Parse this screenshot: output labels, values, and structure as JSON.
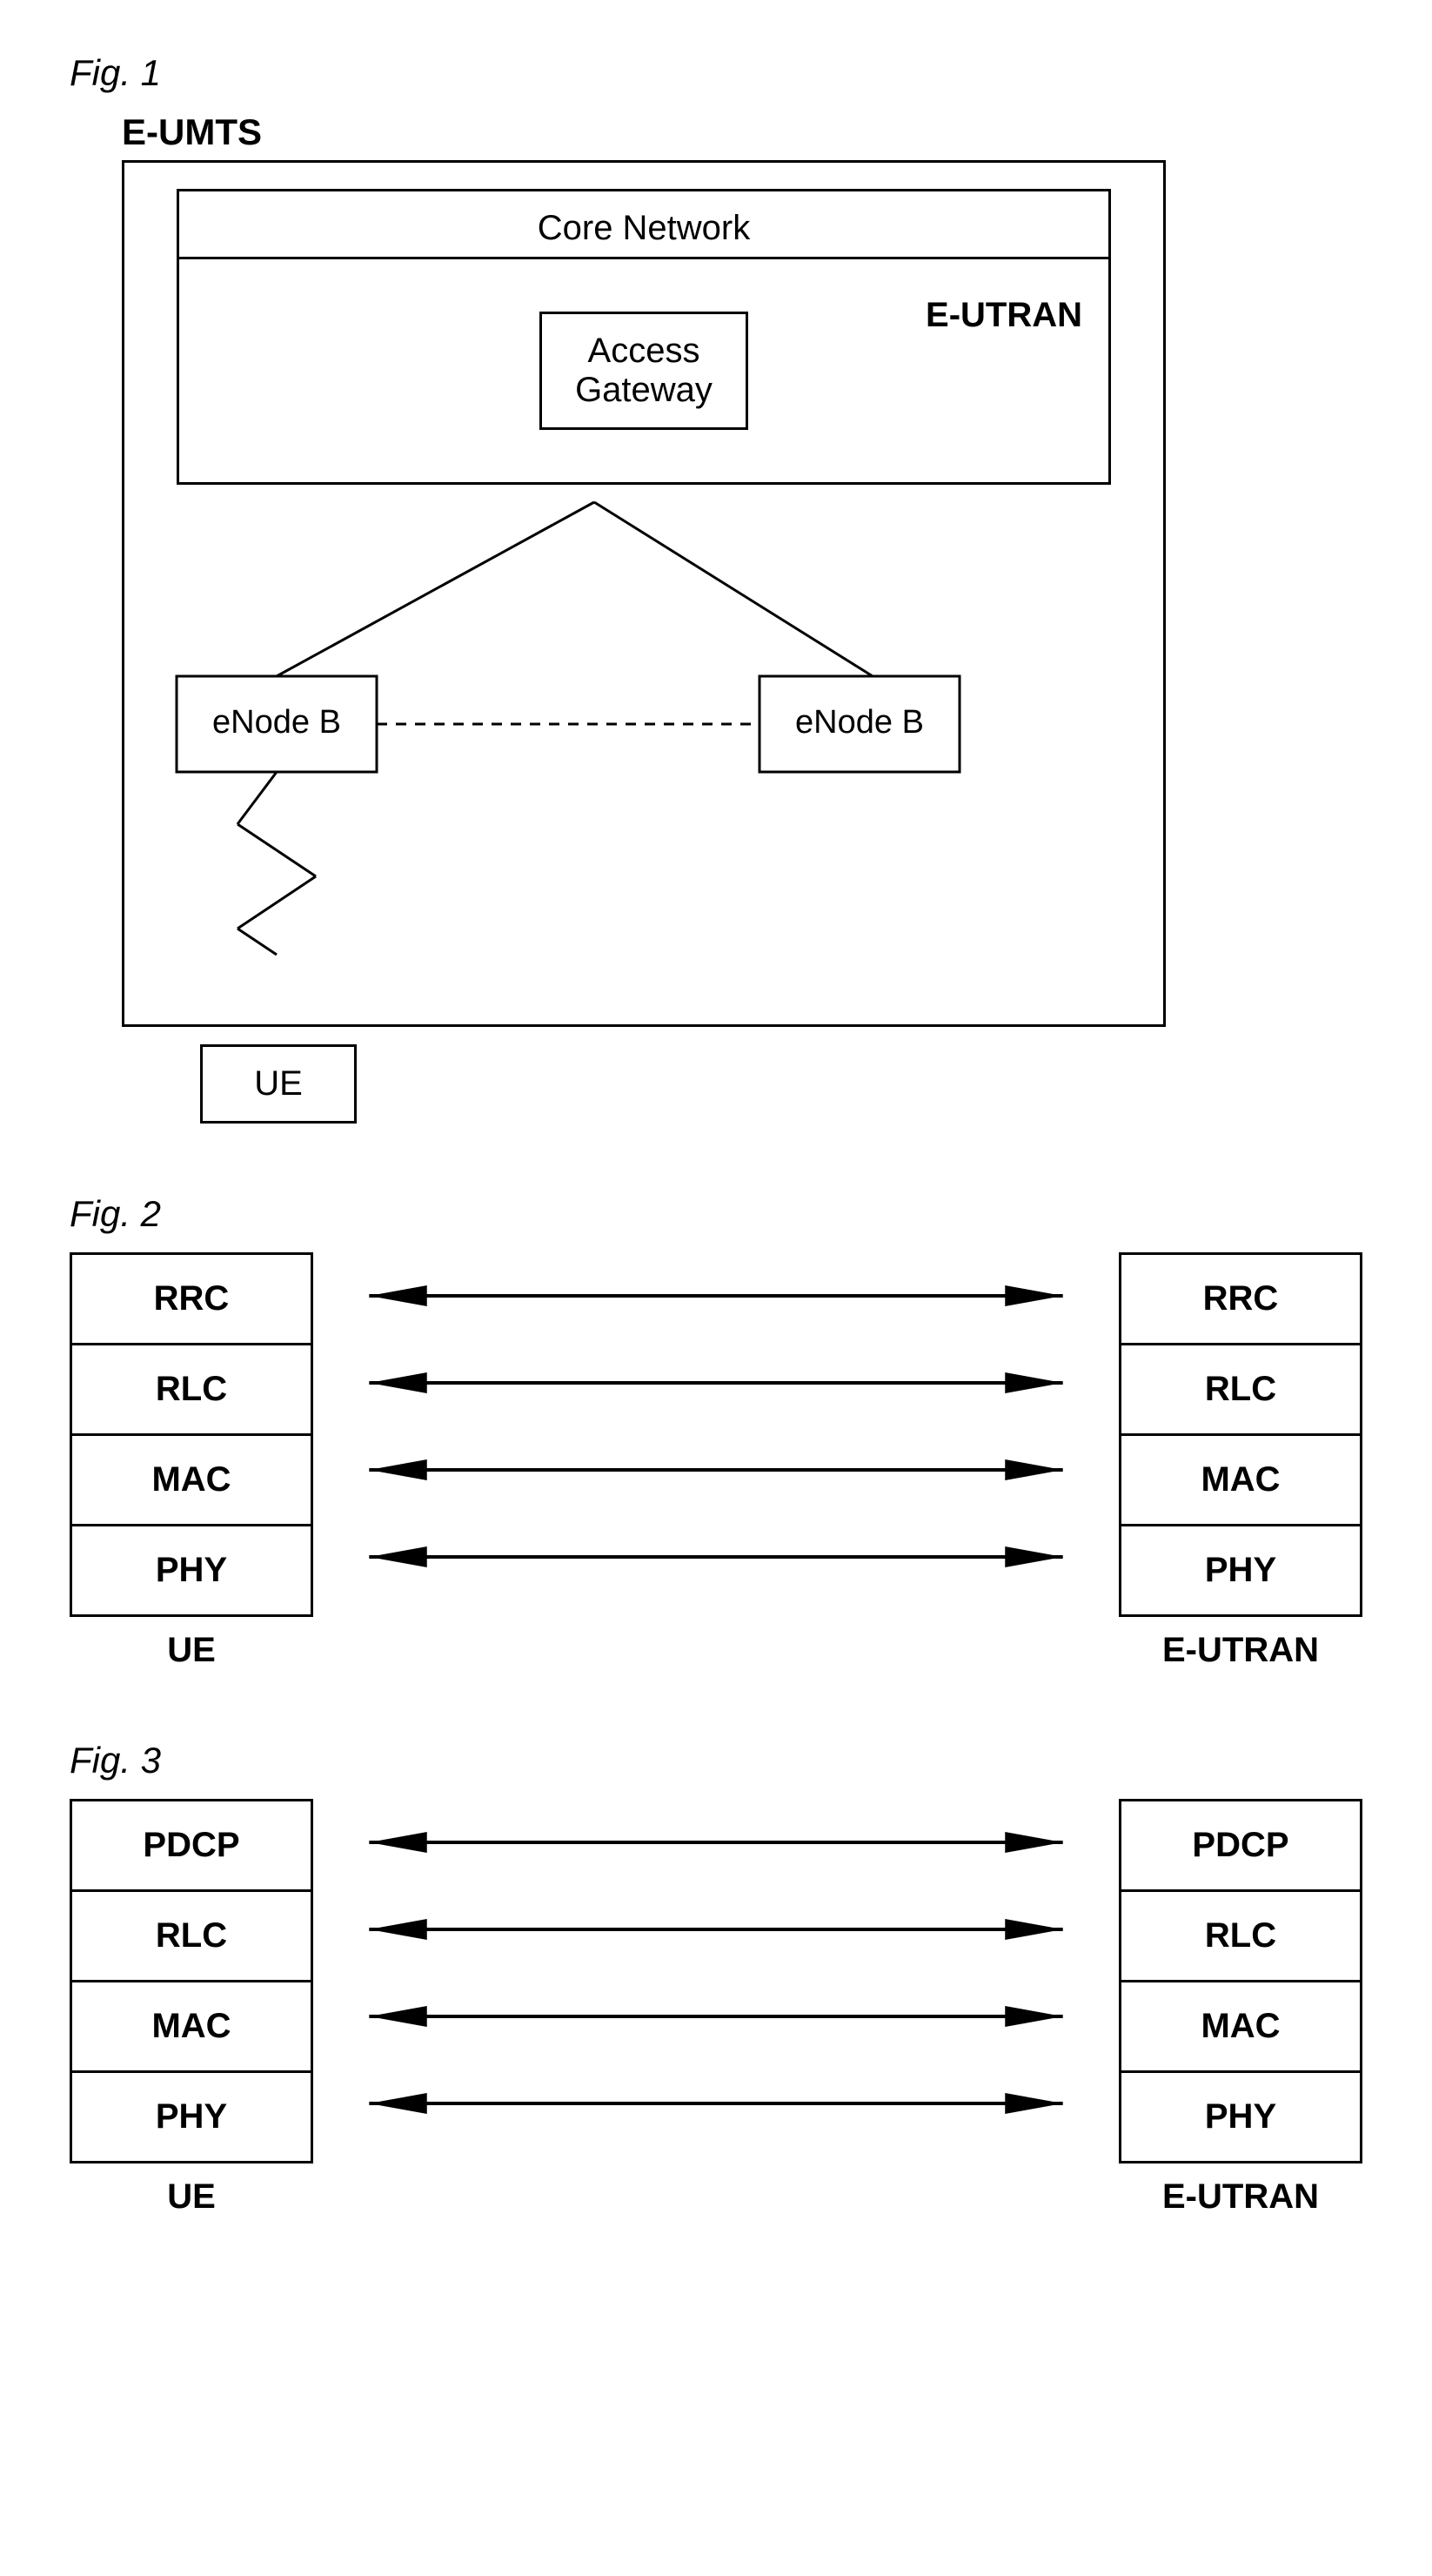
{
  "fig1": {
    "label": "Fig. 1",
    "eumts": "E-UMTS",
    "coreNetwork": "Core Network",
    "accessGateway": "Access\nGateway",
    "eutran": "E-UTRAN",
    "enodeB1": "eNode B",
    "enodeB2": "eNode B",
    "ue": "UE"
  },
  "fig2": {
    "label": "Fig. 2",
    "leftStack": {
      "layers": [
        "RRC",
        "RLC",
        "MAC",
        "PHY"
      ],
      "label": "UE"
    },
    "rightStack": {
      "layers": [
        "RRC",
        "RLC",
        "MAC",
        "PHY"
      ],
      "label": "E-UTRAN"
    }
  },
  "fig3": {
    "label": "Fig. 3",
    "leftStack": {
      "layers": [
        "PDCP",
        "RLC",
        "MAC",
        "PHY"
      ],
      "label": "UE"
    },
    "rightStack": {
      "layers": [
        "PDCP",
        "RLC",
        "MAC",
        "PHY"
      ],
      "label": "E-UTRAN"
    }
  }
}
